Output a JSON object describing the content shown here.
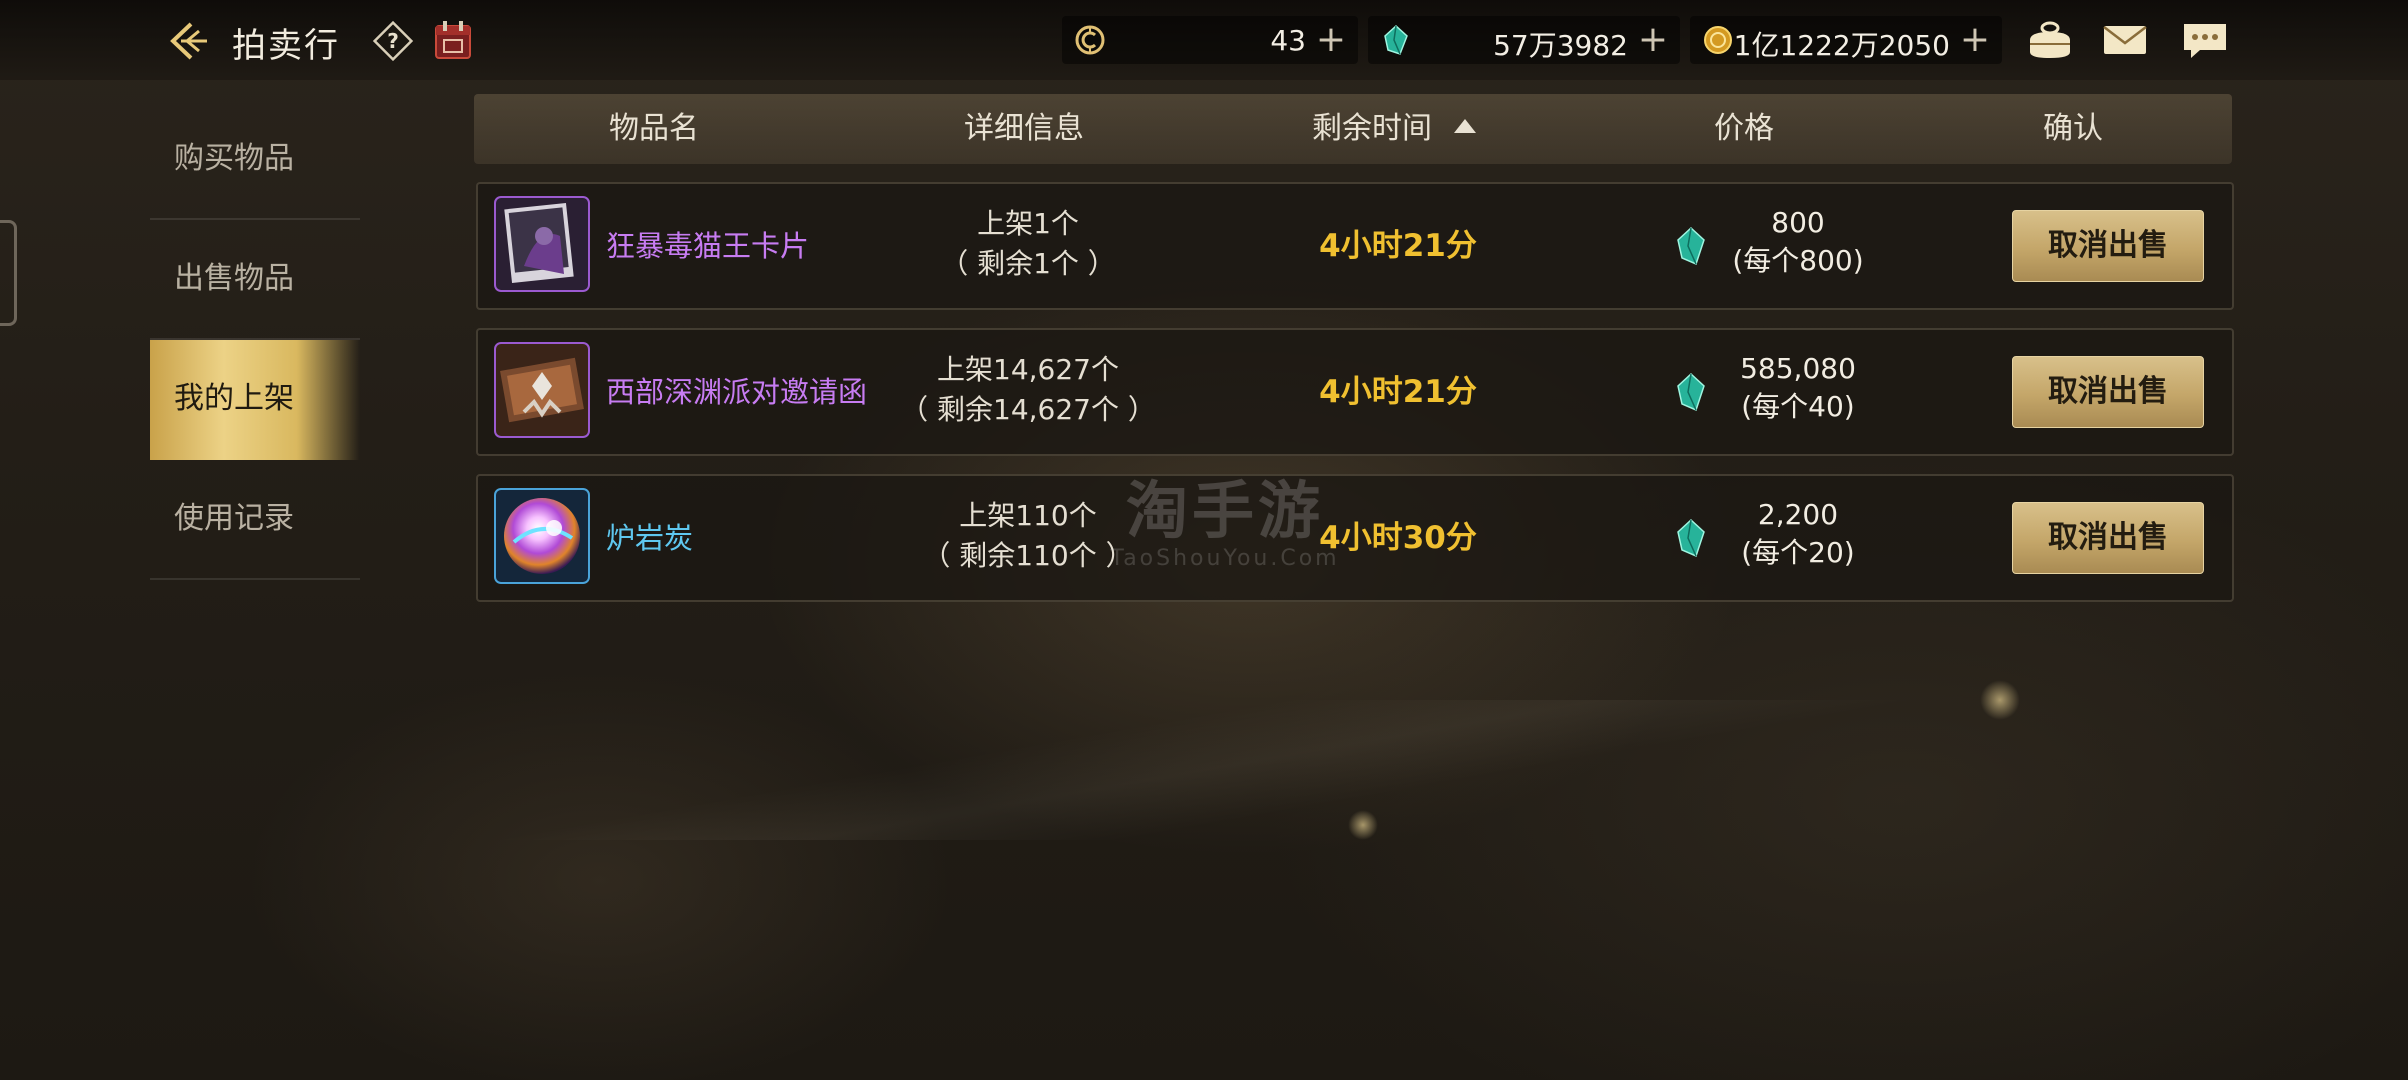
{
  "header": {
    "title": "拍卖行"
  },
  "currencies": [
    {
      "icon": "ticket-coin-icon",
      "value": "43"
    },
    {
      "icon": "gem-icon",
      "value": "57万3982"
    },
    {
      "icon": "gold-coin-icon",
      "value": "1亿1222万2050"
    }
  ],
  "sidebar": {
    "items": [
      {
        "label": "购买物品",
        "active": false
      },
      {
        "label": "出售物品",
        "active": false
      },
      {
        "label": "我的上架",
        "active": true
      },
      {
        "label": "使用记录",
        "active": false
      }
    ]
  },
  "table": {
    "headers": {
      "name": "物品名",
      "detail": "详细信息",
      "time": "剩余时间",
      "price": "价格",
      "confirm": "确认"
    },
    "rows": [
      {
        "name": "狂暴毒猫王卡片",
        "name_color": "#c77cf2",
        "detail_line1": "上架1个",
        "detail_line2": "（ 剩余1个 ）",
        "time": "4小时21分",
        "price_total": "800",
        "price_each": "(每个800)",
        "action": "取消出售"
      },
      {
        "name": "西部深渊派对邀请函",
        "name_color": "#c77cf2",
        "detail_line1": "上架14,627个",
        "detail_line2": "（ 剩余14,627个 ）",
        "time": "4小时21分",
        "price_total": "585,080",
        "price_each": "(每个40)",
        "action": "取消出售"
      },
      {
        "name": "炉岩炭",
        "name_color": "#5fc8f0",
        "detail_line1": "上架110个",
        "detail_line2": "（ 剩余110个 ）",
        "time": "4小时30分",
        "price_total": "2,200",
        "price_each": "(每个20)",
        "action": "取消出售"
      }
    ]
  },
  "watermark": {
    "main": "淘手游",
    "sub": "TaoShouYou.Com"
  },
  "colors": {
    "accent_gold": "#f0c030",
    "active_tab": "#e3c470",
    "rare_item": "#c77cf2",
    "uncommon_item": "#5fc8f0"
  }
}
